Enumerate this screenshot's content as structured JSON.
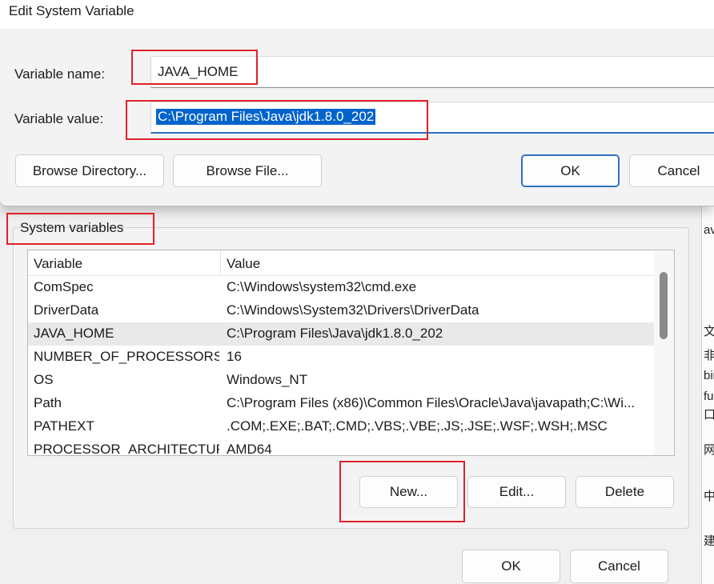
{
  "edit_dialog": {
    "title": "Edit System Variable",
    "name_label": "Variable name:",
    "name_value": "JAVA_HOME",
    "value_label": "Variable value:",
    "value_value": "C:\\Program Files\\Java\\jdk1.8.0_202",
    "browse_directory_label": "Browse Directory...",
    "browse_file_label": "Browse File...",
    "ok_label": "OK",
    "cancel_label": "Cancel"
  },
  "system_variables": {
    "group_label": "System variables",
    "columns": [
      "Variable",
      "Value"
    ],
    "rows": [
      {
        "variable": "ComSpec",
        "value": "C:\\Windows\\system32\\cmd.exe"
      },
      {
        "variable": "DriverData",
        "value": "C:\\Windows\\System32\\Drivers\\DriverData"
      },
      {
        "variable": "JAVA_HOME",
        "value": "C:\\Program Files\\Java\\jdk1.8.0_202",
        "selected": true
      },
      {
        "variable": "NUMBER_OF_PROCESSORS",
        "value": "16"
      },
      {
        "variable": "OS",
        "value": "Windows_NT"
      },
      {
        "variable": "Path",
        "value": "C:\\Program Files (x86)\\Common Files\\Oracle\\Java\\javapath;C:\\Wi..."
      },
      {
        "variable": "PATHEXT",
        "value": ".COM;.EXE;.BAT;.CMD;.VBS;.VBE;.JS;.JSE;.WSF;.WSH;.MSC"
      },
      {
        "variable": "PROCESSOR_ARCHITECTURE",
        "value": "AMD64"
      }
    ],
    "new_label": "New...",
    "edit_label": "Edit...",
    "delete_label": "Delete"
  },
  "env_window": {
    "ok_label": "OK",
    "cancel_label": "Cancel"
  },
  "right_strip_glyphs": [
    "av",
    "文档",
    "非",
    "bin",
    "fu",
    "口，",
    "网",
    "中",
    "建"
  ],
  "colors": {
    "annotation": "#e0202a",
    "selection": "#0063cc",
    "focus_border": "#2f6fc4"
  }
}
